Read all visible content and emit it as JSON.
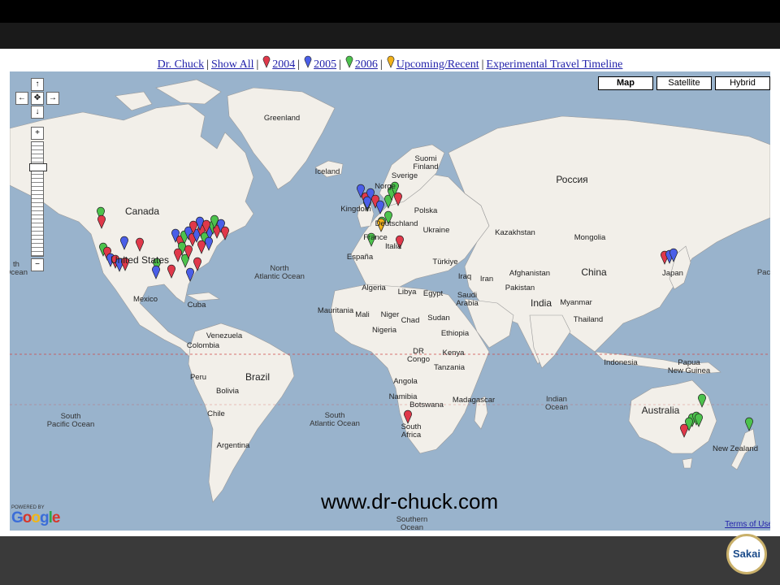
{
  "nav": {
    "author_link": "Dr. Chuck",
    "show_all": "Show All",
    "y2004": "2004",
    "y2005": "2005",
    "y2006": "2006",
    "upcoming": "Upcoming/Recent",
    "timeline": "Experimental Travel Timeline",
    "separator": "|"
  },
  "map_type": {
    "map": "Map",
    "satellite": "Satellite",
    "hybrid": "Hybrid",
    "selected": "Map"
  },
  "labels": {
    "greenland": "Greenland",
    "iceland": "Iceland",
    "canada": "Canada",
    "united_states": "United States",
    "mexico": "Mexico",
    "cuba": "Cuba",
    "north_atlantic": "North\nAtlantic Ocean",
    "venezuela": "Venezuela",
    "colombia": "Colombia",
    "peru": "Peru",
    "brazil": "Brazil",
    "bolivia": "Bolivia",
    "chile": "Chile",
    "argentina": "Argentina",
    "south_pacific": "South\nPacific Ocean",
    "south_atlantic": "South\nAtlantic Ocean",
    "suomi": "Suomi\nFinland",
    "sverige": "Sverige",
    "norge": "Norge",
    "kingdom": "Kingdom",
    "deutschland": "Deutschland",
    "polska": "Polska",
    "france": "France",
    "espana": "España",
    "italia": "Italia",
    "ukraine": "Ukraine",
    "turkiye": "Türkiye",
    "rossiya": "Россия",
    "kazakhstan": "Kazakhstan",
    "mongolia": "Mongolia",
    "china": "China",
    "japan": "Japan",
    "iraq": "Iraq",
    "iran": "Iran",
    "afghanistan": "Afghanistan",
    "pakistan": "Pakistan",
    "india": "India",
    "myanmar": "Myanmar",
    "thailand": "Thailand",
    "algeria": "Algeria",
    "libya": "Libya",
    "egypt": "Egypt",
    "saudi": "Saudi\nArabia",
    "mauritania": "Mauritania",
    "mali": "Mali",
    "niger": "Niger",
    "chad": "Chad",
    "sudan": "Sudan",
    "nigeria": "Nigeria",
    "ethiopia": "Ethiopia",
    "drc": "DR\nCongo",
    "kenya": "Kenya",
    "tanzania": "Tanzania",
    "angola": "Angola",
    "namibia": "Namibia",
    "botswana": "Botswana",
    "south_africa": "South\nAfrica",
    "madagascar": "Madagascar",
    "indian_ocean": "Indian\nOcean",
    "indonesia": "Indonesia",
    "papua": "Papua\nNew Guinea",
    "australia": "Australia",
    "new_zealand": "New Zealand",
    "southern": "Southern\nOcean",
    "pac_left": "th\nOcean",
    "pac_right": "Pac"
  },
  "pins": {
    "colors": {
      "2004": "#e0384a",
      "2005": "#4a5ee8",
      "2006": "#4cc24c",
      "upcoming": "#f2b21b"
    }
  },
  "zoom": {
    "level_fraction": 0.2
  },
  "watermark": "www.dr-chuck.com",
  "powered_by": "POWERED BY",
  "google": "Google",
  "terms": "Terms of Use",
  "sakai": "Sakai"
}
